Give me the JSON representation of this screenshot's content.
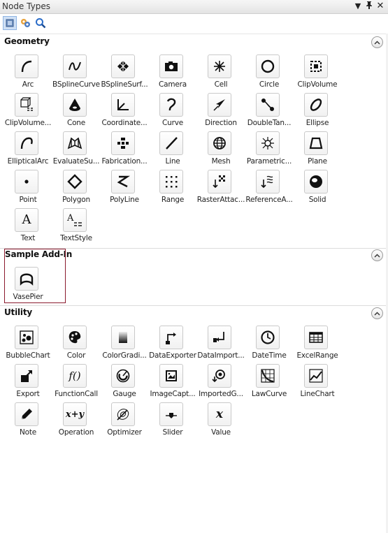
{
  "panel": {
    "title": "Node Types",
    "controls": {
      "dropdown": "▼",
      "pin": "📌",
      "close": "✕"
    }
  },
  "toolbar": {
    "buttons": [
      "category-view",
      "add-in",
      "search"
    ]
  },
  "sections": [
    {
      "name": "Geometry",
      "nodes": [
        "Arc",
        "BSplineCurve",
        "BSplineSurf...",
        "Camera",
        "Cell",
        "Circle",
        "ClipVolume",
        "ClipVolume...",
        "Cone",
        "Coordinate...",
        "Curve",
        "Direction",
        "DoubleTan...",
        "Ellipse",
        "EllipticalArc",
        "EvaluateSu...",
        "Fabrication...",
        "Line",
        "Mesh",
        "Parametric...",
        "Plane",
        "Point",
        "Polygon",
        "PolyLine",
        "Range",
        "RasterAttac...",
        "ReferenceA...",
        "Solid",
        "Text",
        "TextStyle"
      ]
    },
    {
      "name": "Sample Add-In",
      "nodes": [
        "VasePier"
      ]
    },
    {
      "name": "Utility",
      "nodes": [
        "BubbleChart",
        "Color",
        "ColorGradi...",
        "DataExporter",
        "DataImport...",
        "DateTime",
        "ExcelRange",
        "Export",
        "FunctionCall",
        "Gauge",
        "ImageCapt...",
        "ImportedG...",
        "LawCurve",
        "LineChart",
        "Note",
        "Operation",
        "Optimizer",
        "Slider",
        "Value"
      ]
    }
  ],
  "glyphs": {
    "text": "A",
    "textstyle": "A",
    "function": "f()",
    "operation": "x+y",
    "value": "x"
  }
}
